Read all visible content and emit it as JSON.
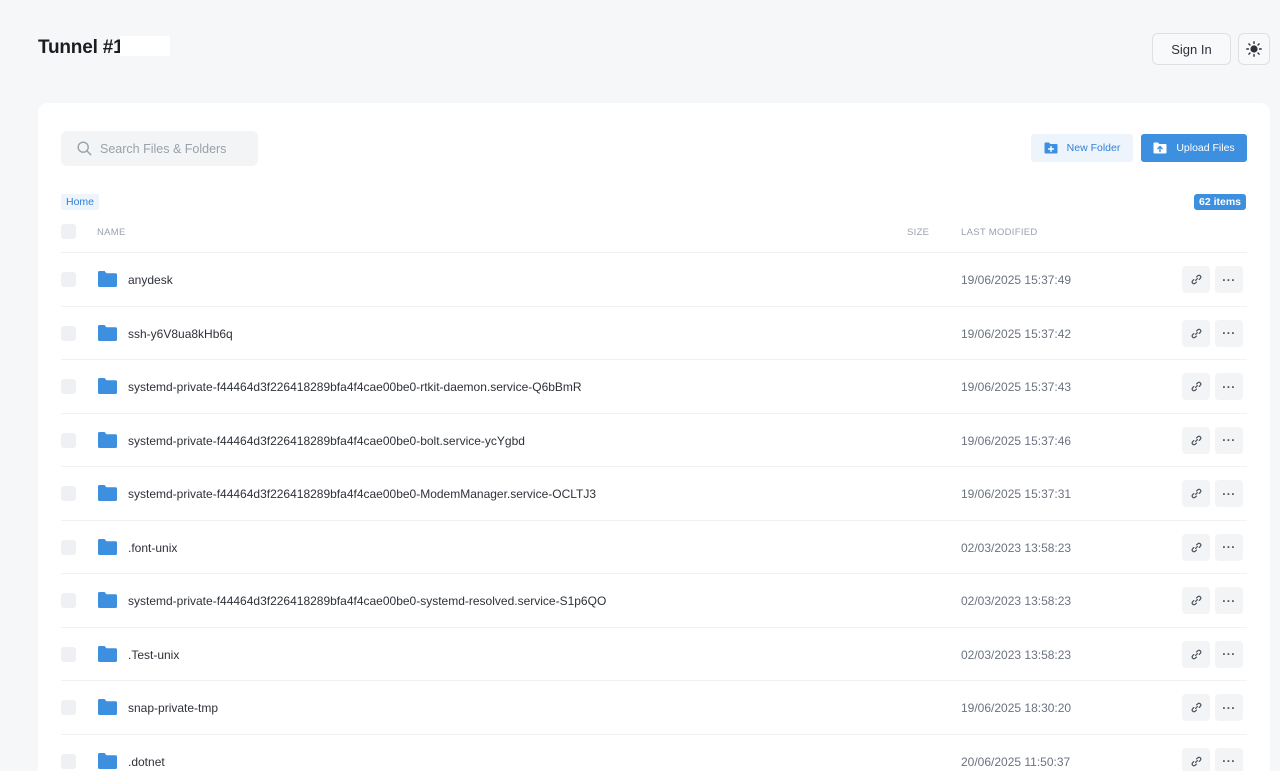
{
  "header": {
    "title": "Tunnel #14",
    "signin_label": "Sign In",
    "theme_icon": "sun-icon"
  },
  "toolbar": {
    "search_placeholder": "Search Files & Folders",
    "new_folder_label": "New Folder",
    "upload_label": "Upload Files"
  },
  "breadcrumb": {
    "home": "Home"
  },
  "item_count": "62 items",
  "table": {
    "headers": {
      "name": "NAME",
      "size": "SIZE",
      "modified": "LAST MODIFIED"
    },
    "rows": [
      {
        "name": "anydesk",
        "modified": "19/06/2025 15:37:49"
      },
      {
        "name": "ssh-y6V8ua8kHb6q",
        "modified": "19/06/2025 15:37:42"
      },
      {
        "name": "systemd-private-f44464d3f226418289bfa4f4cae00be0-rtkit-daemon.service-Q6bBmR",
        "modified": "19/06/2025 15:37:43"
      },
      {
        "name": "systemd-private-f44464d3f226418289bfa4f4cae00be0-bolt.service-ycYgbd",
        "modified": "19/06/2025 15:37:46"
      },
      {
        "name": "systemd-private-f44464d3f226418289bfa4f4cae00be0-ModemManager.service-OCLTJ3",
        "modified": "19/06/2025 15:37:31"
      },
      {
        "name": ".font-unix",
        "modified": "02/03/2023 13:58:23"
      },
      {
        "name": "systemd-private-f44464d3f226418289bfa4f4cae00be0-systemd-resolved.service-S1p6QO",
        "modified": "02/03/2023 13:58:23"
      },
      {
        "name": ".Test-unix",
        "modified": "02/03/2023 13:58:23"
      },
      {
        "name": "snap-private-tmp",
        "modified": "19/06/2025 18:30:20"
      },
      {
        "name": ".dotnet",
        "modified": "20/06/2025 11:50:37"
      }
    ],
    "more_glyph": "···"
  },
  "colors": {
    "accent": "#3d8fe0",
    "folder": "#3d8fe0",
    "background": "#f6f7f9"
  }
}
